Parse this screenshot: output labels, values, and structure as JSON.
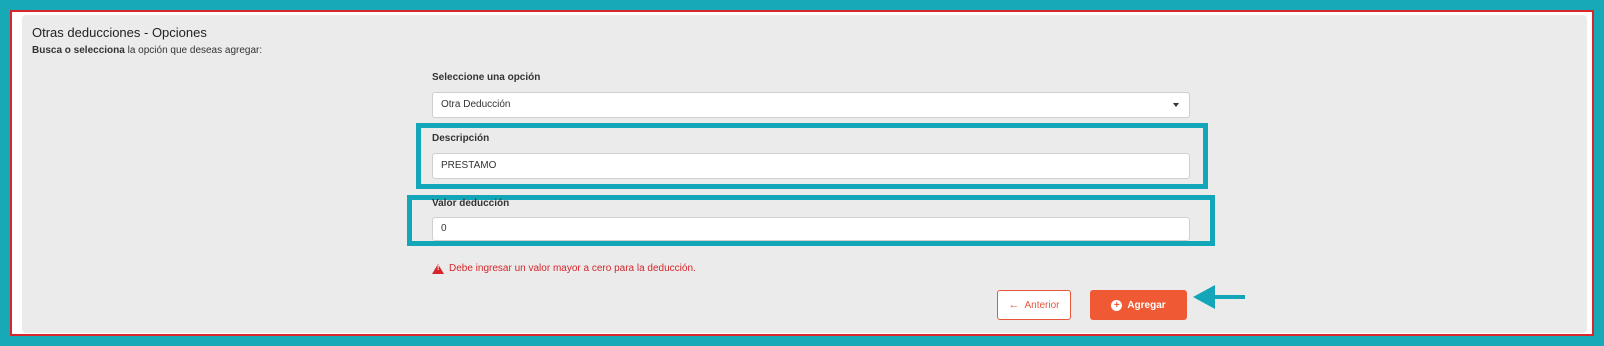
{
  "panel": {
    "title": "Otras deducciones - Opciones",
    "subtitle_bold": "Busca o selecciona",
    "subtitle_rest": " la opción que deseas agregar:"
  },
  "form": {
    "option": {
      "label": "Seleccione una opción",
      "value": "Otra Deducción"
    },
    "description": {
      "label": "Descripción",
      "value": "PRESTAMO"
    },
    "amount": {
      "label": "Valor deducción",
      "value": "0"
    },
    "error": "Debe ingresar un valor mayor a cero para la deducción."
  },
  "buttons": {
    "previous": "Anterior",
    "add": "Agregar"
  },
  "icons": {
    "warning": "warning-icon",
    "back": "arrow-left-icon",
    "add": "plus-circle-icon",
    "pointer": "annotation-arrow-icon"
  },
  "colors": {
    "accent": "#ef5a34",
    "error": "#d6262b",
    "annotation": "#13a6b8",
    "border": "#d9262b"
  }
}
